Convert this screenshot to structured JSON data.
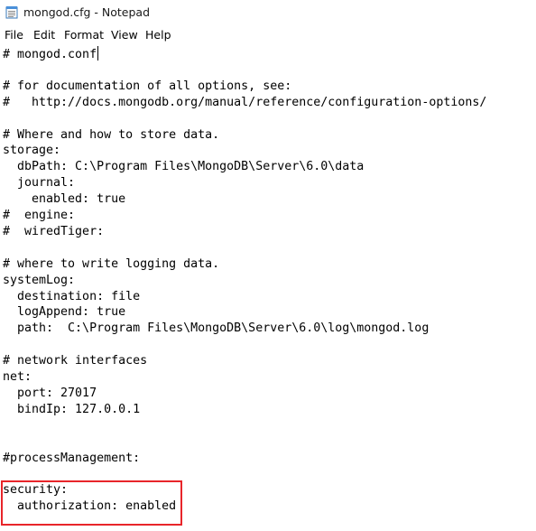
{
  "window": {
    "title": "mongod.cfg - Notepad",
    "icon": "notepad-icon"
  },
  "menu": {
    "items": [
      "File",
      "Edit",
      "Format",
      "View",
      "Help"
    ]
  },
  "editor": {
    "lines": [
      "# mongod.conf",
      "",
      "# for documentation of all options, see:",
      "#   http://docs.mongodb.org/manual/reference/configuration-options/",
      "",
      "# Where and how to store data.",
      "storage:",
      "  dbPath: C:\\Program Files\\MongoDB\\Server\\6.0\\data",
      "  journal:",
      "    enabled: true",
      "#  engine:",
      "#  wiredTiger:",
      "",
      "# where to write logging data.",
      "systemLog:",
      "  destination: file",
      "  logAppend: true",
      "  path:  C:\\Program Files\\MongoDB\\Server\\6.0\\log\\mongod.log",
      "",
      "# network interfaces",
      "net:",
      "  port: 27017",
      "  bindIp: 127.0.0.1",
      "",
      "",
      "#processManagement:",
      "",
      "security:",
      "  authorization: enabled"
    ]
  },
  "colors": {
    "highlight_border": "#e8252a"
  }
}
